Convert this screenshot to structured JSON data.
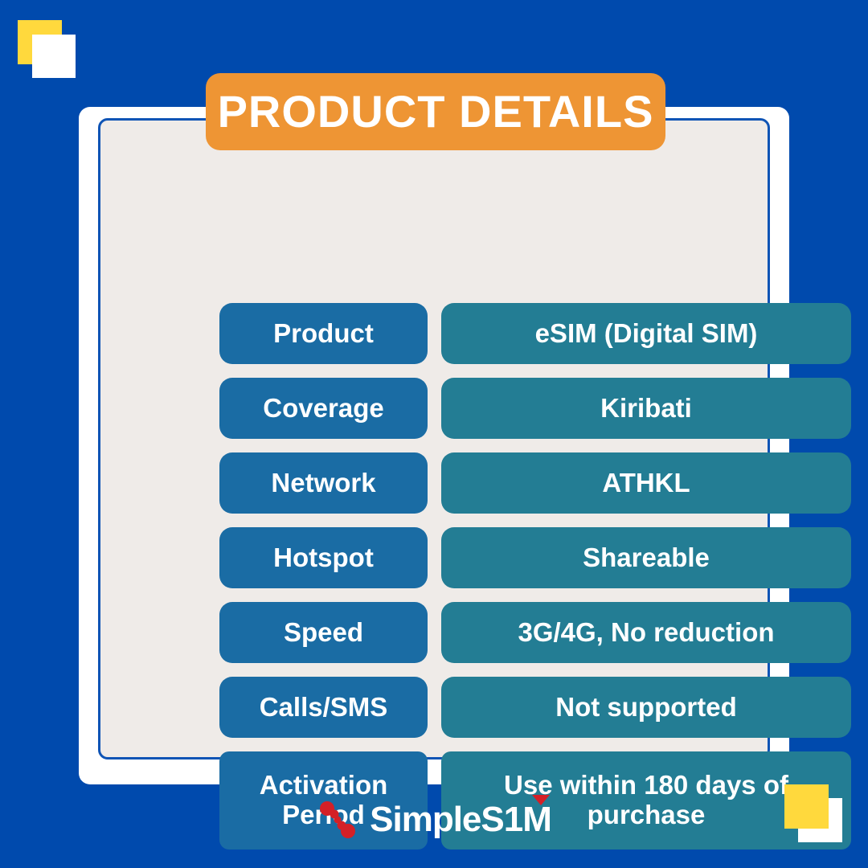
{
  "theme": {
    "background": "#004AAD",
    "card_background": "#FFFFFF",
    "panel_background": "#EFEBE8",
    "panel_border": "#0F54B5",
    "title_badge": "#EE9534",
    "label_pill": "#1A6CA4",
    "value_pill": "#237D94",
    "accent_yellow": "#FFD93D",
    "logo_red": "#D42027",
    "text_on_pill": "#FFFFFF"
  },
  "header": {
    "title": "PRODUCT DETAILS"
  },
  "details": {
    "rows": [
      {
        "label": "Product",
        "value": "eSIM (Digital SIM)"
      },
      {
        "label": "Coverage",
        "value": "Kiribati"
      },
      {
        "label": "Network",
        "value": "ATHKL"
      },
      {
        "label": "Hotspot",
        "value": "Shareable"
      },
      {
        "label": "Speed",
        "value": "3G/4G, No reduction"
      },
      {
        "label": "Calls/SMS",
        "value": "Not supported"
      },
      {
        "label": "Activation Period",
        "value": "Use within 180 days of purchase"
      }
    ]
  },
  "footer": {
    "brand_name": "SimpleS1M",
    "logo_mark": "molecule-dots-icon",
    "logo_accent": "triangle-accent-icon"
  },
  "decorations": {
    "top_left": {
      "back_square": "yellow-square",
      "front_square": "white-square"
    },
    "bottom_right": {
      "back_square": "white-square",
      "front_square": "yellow-square"
    }
  }
}
